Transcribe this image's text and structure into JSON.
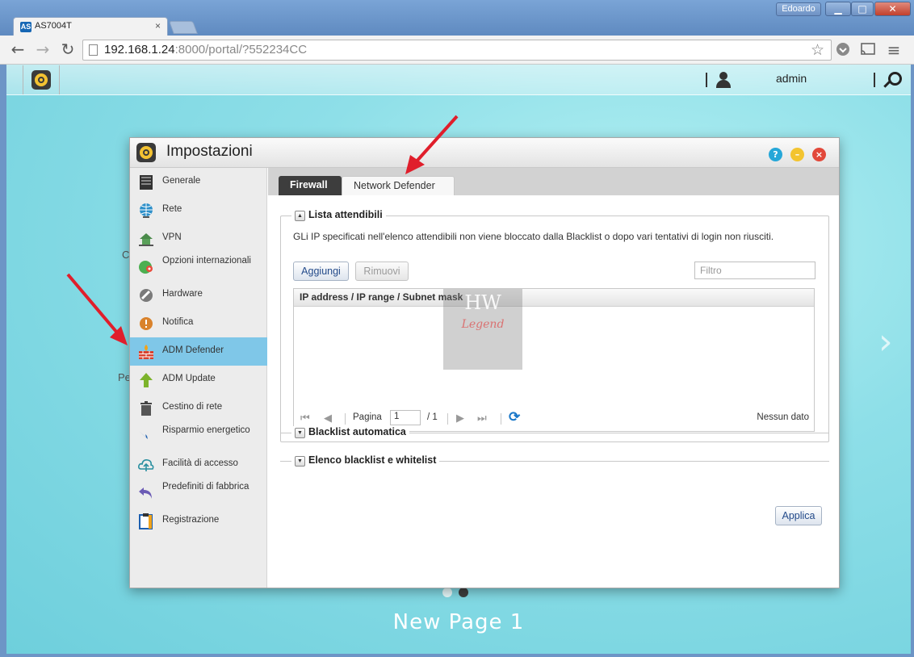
{
  "browser": {
    "tab_title": "AS7004T",
    "tab_favicon": "AS",
    "tab_close": "×",
    "user_badge": "Edoardo",
    "url_host": "192.168.1.24",
    "url_rest": ":8000/portal/?552234CC",
    "back_icon": "←",
    "forward_icon": "→",
    "reload_icon": "↻",
    "star_icon": "☆",
    "menu_icon": "≡",
    "min_glyph": "▁",
    "max_glyph": "□",
    "close_glyph": "✕"
  },
  "adm": {
    "user": "admin"
  },
  "desktop": {
    "page_label": "New Page 1",
    "next_glyph": "›",
    "partial_label_1": "C",
    "partial_label_2": "Pe"
  },
  "settings": {
    "title": "Impostazioni",
    "help_glyph": "?",
    "min_glyph": "–",
    "close_glyph": "×",
    "sidebar": [
      {
        "label": "Generale",
        "icon": "server-icon"
      },
      {
        "label": "Rete",
        "icon": "globe-icon"
      },
      {
        "label": "VPN",
        "icon": "vpn-house-icon"
      },
      {
        "label": "Opzioni internazionali",
        "icon": "international-icon"
      },
      {
        "label": "Hardware",
        "icon": "hardware-icon"
      },
      {
        "label": "Notifica",
        "icon": "notification-icon"
      },
      {
        "label": "ADM Defender",
        "icon": "firewall-wall-icon"
      },
      {
        "label": "ADM Update",
        "icon": "update-arrow-icon"
      },
      {
        "label": "Cestino di rete",
        "icon": "trash-icon"
      },
      {
        "label": "Risparmio energetico",
        "icon": "lightning-icon"
      },
      {
        "label": "Facilità di accesso",
        "icon": "cloud-upload-icon"
      },
      {
        "label": "Predefiniti di fabbrica",
        "icon": "undo-arrow-icon"
      },
      {
        "label": "Registrazione",
        "icon": "clipboard-icon"
      }
    ],
    "active_item": "ADM Defender",
    "tabs": [
      "Firewall",
      "Network Defender"
    ],
    "active_tab": "Network Defender",
    "sections": {
      "trusted_title": "Lista attendibili",
      "trusted_desc": "GLi IP specificati nell'elenco attendibili non viene bloccato dalla Blacklist o dopo vari tentativi di login non riusciti.",
      "add_button": "Aggiungi",
      "remove_button": "Rimuovi",
      "filter_placeholder": "Filtro",
      "column_header": "IP address / IP range / Subnet mask",
      "page_label": "Pagina",
      "page_value": "1",
      "page_total": "/ 1",
      "no_data": "Nessun dato",
      "auto_blacklist_title": "Blacklist automatica",
      "lists_title": "Elenco blacklist e whitelist",
      "collapse_glyph": "▲",
      "expand_glyph": "▼",
      "apply_button": "Applica",
      "pager_first": "⏮",
      "pager_prev": "◀",
      "pager_next": "▶",
      "pager_last": "⏭",
      "refresh_glyph": "⟳"
    },
    "watermark": {
      "line1": "HW",
      "line2": "Legend"
    }
  }
}
